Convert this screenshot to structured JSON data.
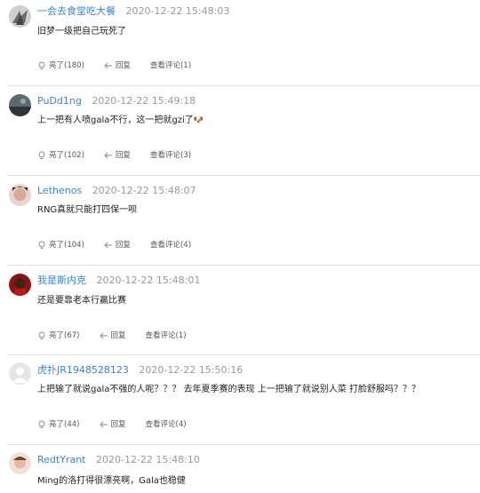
{
  "labels": {
    "like": "亮了",
    "reply": "回复",
    "view": "查看评论"
  },
  "colors": {
    "username": "#3b82d6",
    "timestamp": "#9a9a9a",
    "separator": "#e5e5e5"
  },
  "comments": [
    {
      "username": "一会去食堂吃大餐",
      "timestamp": "2020-12-22 15:48:03",
      "text": "旧梦一级把自己玩死了",
      "likes": "180",
      "replies": "1"
    },
    {
      "username": "PuDd1ng",
      "timestamp": "2020-12-22 15:49:18",
      "text": "上一把有人喷gala不行，这一把就gzi了",
      "likes": "102",
      "replies": "3"
    },
    {
      "username": "Lethenos",
      "timestamp": "2020-12-22 15:48:07",
      "text": "RNG真就只能打四保一呗",
      "likes": "104",
      "replies": "4"
    },
    {
      "username": "我是斯内克",
      "timestamp": "2020-12-22 15:48:01",
      "text": "还是要靠老本行赢比赛",
      "likes": "67",
      "replies": "1"
    },
    {
      "username": "虎扑JR1948528123",
      "timestamp": "2020-12-22 15:50:16",
      "text": "上把输了就说gala不强的人呢？？？  去年夏季赛的表现  上一把输了就说别人菜  打脸舒服吗？？？",
      "likes": "44",
      "replies": "4"
    },
    {
      "username": "RedtYrant",
      "timestamp": "2020-12-22 15:48:10",
      "text": "Ming的洛打得很漂亮啊，Gala也稳健",
      "likes": "",
      "replies": ""
    }
  ]
}
